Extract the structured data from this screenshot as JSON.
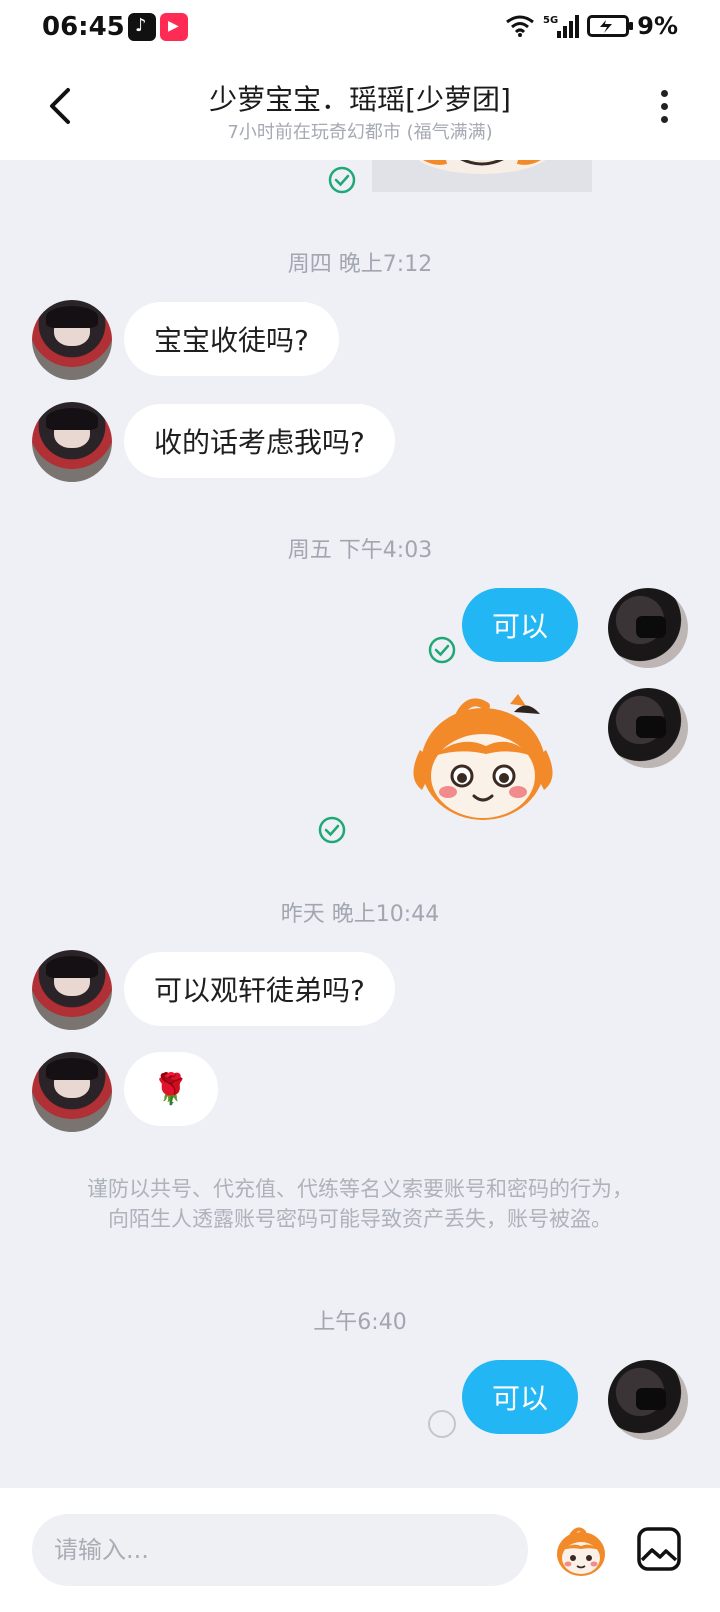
{
  "status_bar": {
    "time": "06:45",
    "battery": "9%",
    "network": "5G"
  },
  "header": {
    "title": "少萝宝宝．瑶瑶[少萝团]",
    "subtitle": "7小时前在玩奇幻都市 (福气满满)"
  },
  "messages": {
    "ts1": "周四 晚上7:12",
    "m1": "宝宝收徒吗?",
    "m2": "收的话考虑我吗?",
    "ts2": "周五 下午4:03",
    "m3": "可以",
    "ts3": "昨天 晚上10:44",
    "m4": "可以观轩徒弟吗?",
    "m5": "🌹",
    "notice_line1": "谨防以共号、代充值、代练等名义索要账号和密码的行为，",
    "notice_line2": "向陌生人透露账号密码可能导致资产丢失，账号被盗。",
    "ts4": "上午6:40",
    "m6": "可以"
  },
  "input": {
    "placeholder": "请输入..."
  },
  "colors": {
    "accent": "#22b6f5",
    "read_check": "#1fa874",
    "background": "#eef0f6"
  }
}
